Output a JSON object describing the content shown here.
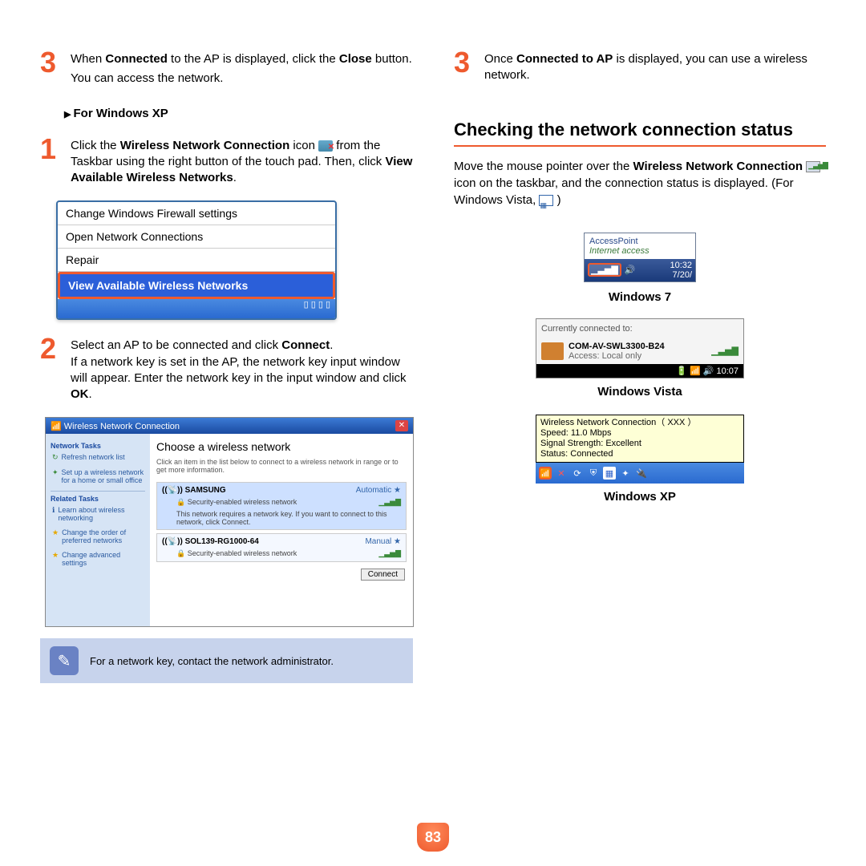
{
  "left": {
    "step3a": {
      "num": "3",
      "text_pre": "When ",
      "b1": "Connected",
      "text_mid": " to the AP is displayed, click the ",
      "b2": "Close",
      "text_post": " button.",
      "sub": "You can access the network."
    },
    "for_xp": "For Windows XP",
    "step1": {
      "num": "1",
      "l1a": "Click the ",
      "l1b": "Wireless Network Connection",
      "l1c": " icon",
      "l2": " from the Taskbar using the right button of the touch pad. Then, click ",
      "l2b": "View Available Wireless Networks",
      "l2c": "."
    },
    "ctxmenu": {
      "i1": "Change Windows Firewall settings",
      "i2": "Open Network Connections",
      "i3": "Repair",
      "i4": "View Available Wireless Networks"
    },
    "step2": {
      "num": "2",
      "l1a": "Select an AP to be connected and click ",
      "l1b": "Connect",
      "l1c": ".",
      "l2a": "If a network key is set in the AP, the network key input window will appear. Enter the network key in the input window and click ",
      "l2b": "OK",
      "l2c": "."
    },
    "wnc": {
      "title": "Wireless Network Connection",
      "tasks_h": "Network Tasks",
      "t1": "Refresh network list",
      "t2": "Set up a wireless network for a home or small office",
      "related_h": "Related Tasks",
      "r1": "Learn about wireless networking",
      "r2": "Change the order of preferred networks",
      "r3": "Change advanced settings",
      "main_title": "Choose a wireless network",
      "main_desc": "Click an item in the list below to connect to a wireless network in range or to get more information.",
      "n1_name": "SAMSUNG",
      "n1_mode": "Automatic",
      "n1_sec": "Security-enabled wireless network",
      "n1_desc": "This network requires a network key. If you want to connect to this network, click Connect.",
      "n2_name": "SOL139-RG1000-64",
      "n2_mode": "Manual",
      "n2_sec": "Security-enabled wireless network",
      "connect": "Connect"
    },
    "note": "For a network key, contact the network administrator."
  },
  "right": {
    "step3b": {
      "num": "3",
      "l1a": "Once ",
      "l1b": "Connected to AP",
      "l1c": " is displayed, you can use a wireless network."
    },
    "section": "Checking the network connection status",
    "para_a": "Move the mouse pointer over the ",
    "para_b": "Wireless Network Connection",
    "para_c": " icon on the taskbar, and the connection status is displayed. (For Windows Vista, ",
    "para_d": ")",
    "w7": {
      "ap": "AccessPoint",
      "sub": "Internet access",
      "time": "10:32",
      "date": "7/20/",
      "cap": "Windows 7"
    },
    "vista": {
      "h": "Currently connected to:",
      "name": "COM-AV-SWL3300-B24",
      "access": "Access:  Local only",
      "time": "10:07",
      "cap": "Windows Vista"
    },
    "xp": {
      "l1": "Wireless Network Connection（ XXX ）",
      "l2": "Speed: 11.0 Mbps",
      "l3": "Signal Strength: Excellent",
      "l4": "Status:  Connected",
      "cap": "Windows XP"
    }
  },
  "pagenum": "83"
}
